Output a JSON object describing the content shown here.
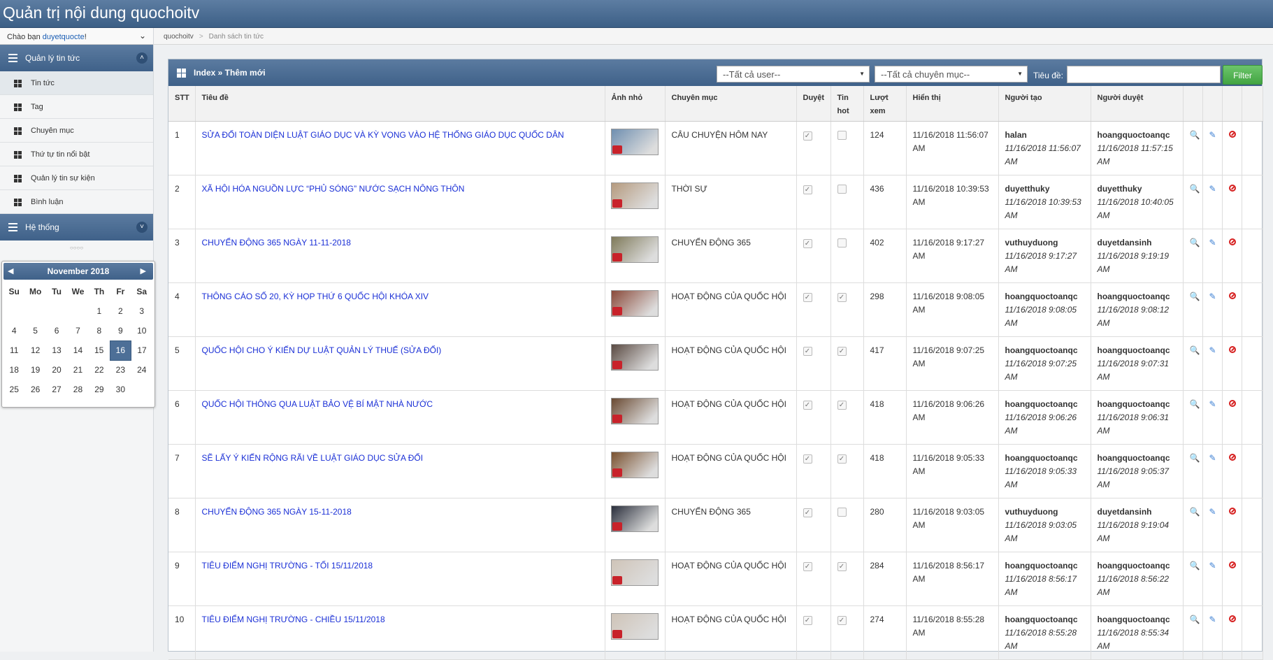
{
  "app": {
    "title": "Quản trị nội dung quochoitv"
  },
  "sidebar": {
    "greeting_prefix": "Chào bạn ",
    "username": "duyetquocte",
    "greeting_suffix": "!",
    "section1": "Quản lý tin tức",
    "items": [
      {
        "label": "Tin tức",
        "active": true
      },
      {
        "label": "Tag"
      },
      {
        "label": "Chuyên mục"
      },
      {
        "label": "Thứ tự tin nổi bật"
      },
      {
        "label": "Quản lý tin sự kiện"
      },
      {
        "label": "Bình luận"
      }
    ],
    "section2": "Hệ thống"
  },
  "calendar": {
    "month_label": "November 2018",
    "weekdays": [
      "Su",
      "Mo",
      "Tu",
      "We",
      "Th",
      "Fr",
      "Sa"
    ],
    "weeks": [
      [
        "",
        "",
        "",
        "",
        "1",
        "2",
        "3"
      ],
      [
        "4",
        "5",
        "6",
        "7",
        "8",
        "9",
        "10"
      ],
      [
        "11",
        "12",
        "13",
        "14",
        "15",
        "16",
        "17"
      ],
      [
        "18",
        "19",
        "20",
        "21",
        "22",
        "23",
        "24"
      ],
      [
        "25",
        "26",
        "27",
        "28",
        "29",
        "30",
        ""
      ]
    ],
    "selected": "16"
  },
  "breadcrumb": {
    "root": "quochoitv",
    "current": "Danh sách tin tức"
  },
  "panel": {
    "title": "Index » Thêm mới",
    "user_select": "--Tất cả user--",
    "category_select": "--Tất cả chuyên mục--",
    "title_label": "Tiêu đề:",
    "title_input_value": "",
    "filter_button": "Filter"
  },
  "table": {
    "headers": {
      "stt": "STT",
      "title": "Tiêu đề",
      "thumb": "Ảnh nhỏ",
      "category": "Chuyên mục",
      "approved": "Duyệt",
      "hot1": "Tin",
      "hot2": "hot",
      "views1": "Lượt",
      "views2": "xem",
      "display": "Hiển thị",
      "creator": "Người tạo",
      "approver": "Người duyệt"
    },
    "rows": [
      {
        "stt": "1",
        "title": "SỬA ĐỔI TOÀN DIỆN LUẬT GIÁO DỤC VÀ KỲ VỌNG VÀO HỆ THỐNG GIÁO DỤC QUỐC DÂN",
        "category": "CÂU CHUYỆN HÔM NAY",
        "approved": true,
        "hot": false,
        "views": "124",
        "display1": "11/16/2018 11:56:07",
        "display2": "AM",
        "creator": "halan",
        "created1": "11/16/2018 11:56:07",
        "created2": "AM",
        "approver": "hoangquoctoanqc",
        "approved1": "11/16/2018 11:57:15",
        "approved2": "AM",
        "thumb_color": "#6f8fb0"
      },
      {
        "stt": "2",
        "title": "XÃ HỘI HÓA NGUỒN LỰC “PHỦ SÓNG” NƯỚC SẠCH NÔNG THÔN",
        "category": "THỜI SỰ",
        "approved": true,
        "hot": false,
        "views": "436",
        "display1": "11/16/2018 10:39:53",
        "display2": "AM",
        "creator": "duyetthuky",
        "created1": "11/16/2018 10:39:53",
        "created2": "AM",
        "approver": "duyetthuky",
        "approved1": "11/16/2018 10:40:05",
        "approved2": "AM",
        "thumb_color": "#b59a7e"
      },
      {
        "stt": "3",
        "title": "CHUYỂN ĐỘNG 365 NGÀY 11-11-2018",
        "category": "CHUYỂN ĐỘNG 365",
        "approved": true,
        "hot": false,
        "views": "402",
        "display1": "11/16/2018 9:17:27",
        "display2": "AM",
        "creator": "vuthuyduong",
        "created1": "11/16/2018 9:17:27",
        "created2": "AM",
        "approver": "duyetdansinh",
        "approved1": "11/16/2018 9:19:19",
        "approved2": "AM",
        "thumb_color": "#7f7a5a"
      },
      {
        "stt": "4",
        "title": "THÔNG CÁO SỐ 20, KỲ HỌP THỨ 6 QUỐC HỘI KHÓA XIV",
        "category": "HOẠT ĐỘNG CỦA QUỐC HỘI",
        "approved": true,
        "hot": true,
        "views": "298",
        "display1": "11/16/2018 9:08:05",
        "display2": "AM",
        "creator": "hoangquoctoanqc",
        "created1": "11/16/2018 9:08:05",
        "created2": "AM",
        "approver": "hoangquoctoanqc",
        "approved1": "11/16/2018 9:08:12",
        "approved2": "AM",
        "thumb_color": "#8a4a3a"
      },
      {
        "stt": "5",
        "title": "QUỐC HỘI CHO Ý KIẾN DỰ LUẬT QUẢN LÝ THUẾ (SỬA ĐỔI)",
        "category": "HOẠT ĐỘNG CỦA QUỐC HỘI",
        "approved": true,
        "hot": true,
        "views": "417",
        "display1": "11/16/2018 9:07:25",
        "display2": "AM",
        "creator": "hoangquoctoanqc",
        "created1": "11/16/2018 9:07:25",
        "created2": "AM",
        "approver": "hoangquoctoanqc",
        "approved1": "11/16/2018 9:07:31",
        "approved2": "AM",
        "thumb_color": "#5a4a42"
      },
      {
        "stt": "6",
        "title": "QUỐC HỘI THÔNG QUA LUẬT BẢO VỆ BÍ MẬT NHÀ NƯỚC",
        "category": "HOẠT ĐỘNG CỦA QUỐC HỘI",
        "approved": true,
        "hot": true,
        "views": "418",
        "display1": "11/16/2018 9:06:26",
        "display2": "AM",
        "creator": "hoangquoctoanqc",
        "created1": "11/16/2018 9:06:26",
        "created2": "AM",
        "approver": "hoangquoctoanqc",
        "approved1": "11/16/2018 9:06:31",
        "approved2": "AM",
        "thumb_color": "#6a4a32"
      },
      {
        "stt": "7",
        "title": "SẼ LẤY Ý KIẾN RỘNG RÃI VỀ LUẬT GIÁO DỤC SỬA ĐỔI",
        "category": "HOẠT ĐỘNG CỦA QUỐC HỘI",
        "approved": true,
        "hot": true,
        "views": "418",
        "display1": "11/16/2018 9:05:33",
        "display2": "AM",
        "creator": "hoangquoctoanqc",
        "created1": "11/16/2018 9:05:33",
        "created2": "AM",
        "approver": "hoangquoctoanqc",
        "approved1": "11/16/2018 9:05:37",
        "approved2": "AM",
        "thumb_color": "#7a5230"
      },
      {
        "stt": "8",
        "title": "CHUYỂN ĐỘNG 365 NGÀY 15-11-2018",
        "category": "CHUYỂN ĐỘNG 365",
        "approved": true,
        "hot": false,
        "views": "280",
        "display1": "11/16/2018 9:03:05",
        "display2": "AM",
        "creator": "vuthuyduong",
        "created1": "11/16/2018 9:03:05",
        "created2": "AM",
        "approver": "duyetdansinh",
        "approved1": "11/16/2018 9:19:04",
        "approved2": "AM",
        "thumb_color": "#2a2f3c"
      },
      {
        "stt": "9",
        "title": "TIÊU ĐIỂM NGHỊ TRƯỜNG - TỐI 15/11/2018",
        "category": "HOẠT ĐỘNG CỦA QUỐC HỘI",
        "approved": true,
        "hot": true,
        "views": "284",
        "display1": "11/16/2018 8:56:17",
        "display2": "AM",
        "creator": "hoangquoctoanqc",
        "created1": "11/16/2018 8:56:17",
        "created2": "AM",
        "approver": "hoangquoctoanqc",
        "approved1": "11/16/2018 8:56:22",
        "approved2": "AM",
        "thumb_color": "#cfc4b8"
      },
      {
        "stt": "10",
        "title": "TIÊU ĐIỂM NGHỊ TRƯỜNG - CHIỀU 15/11/2018",
        "category": "HOẠT ĐỘNG CỦA QUỐC HỘI",
        "approved": true,
        "hot": true,
        "views": "274",
        "display1": "11/16/2018 8:55:28",
        "display2": "AM",
        "creator": "hoangquoctoanqc",
        "created1": "11/16/2018 8:55:28",
        "created2": "AM",
        "approver": "hoangquoctoanqc",
        "approved1": "11/16/2018 8:55:34",
        "approved2": "AM",
        "thumb_color": "#cfc4b8"
      }
    ]
  },
  "icons": {
    "view": "magnifier-icon",
    "edit": "edit-icon",
    "delete": "delete-icon"
  }
}
